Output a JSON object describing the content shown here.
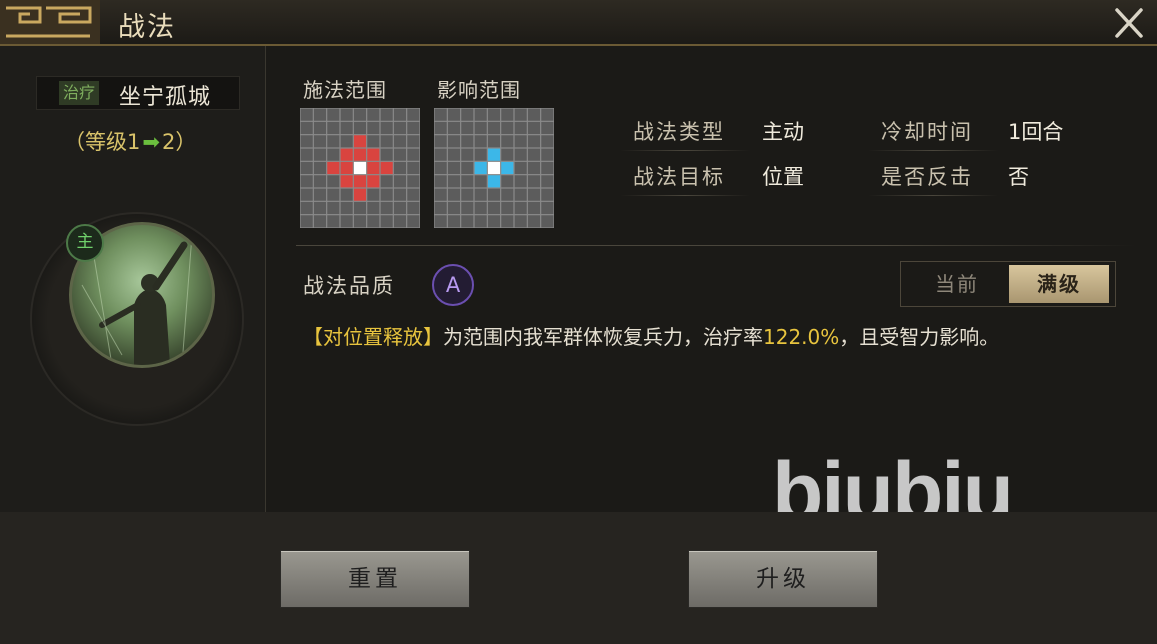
{
  "window": {
    "title": "战法"
  },
  "skill": {
    "tag": "治疗",
    "name": "坐宁孤城",
    "level_prefix": "（等级1",
    "level_arrow": "➡",
    "level_suffix": "2）",
    "main_badge": "主"
  },
  "ranges": {
    "cast_label": "施法范围",
    "effect_label": "影响范围"
  },
  "attributes": [
    {
      "label": "战法类型",
      "value": "主动"
    },
    {
      "label": "冷却时间",
      "value": "1回合"
    },
    {
      "label": "战法目标",
      "value": "位置"
    },
    {
      "label": "是否反击",
      "value": "否"
    }
  ],
  "quality": {
    "label": "战法品质",
    "grade": "A"
  },
  "toggle": {
    "current": "当前",
    "max": "满级"
  },
  "description": {
    "tag": "【对位置释放】",
    "text1": "为范围内我军群体恢复兵力，治疗率",
    "rate": "122.0%",
    "text2": "，且受智力影响。"
  },
  "watermark": "biubiu",
  "buttons": {
    "reset": "重置",
    "upgrade": "升级"
  },
  "icons": {
    "close": "close-icon",
    "main": "main-badge-icon"
  },
  "colors": {
    "cast_range": "#d9443f",
    "effect_range": "#3cb7e8",
    "center": "#ffffff",
    "highlight": "#e8c43e",
    "level_arrow": "#6bbf3e"
  }
}
